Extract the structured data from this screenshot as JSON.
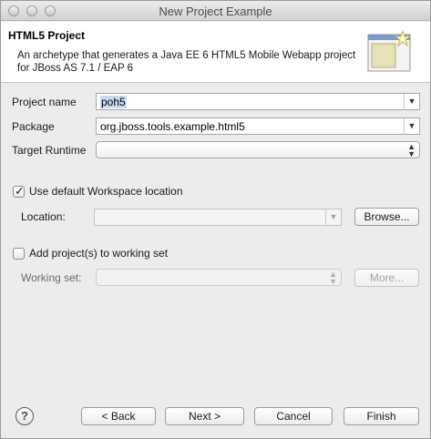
{
  "window": {
    "title": "New Project Example"
  },
  "banner": {
    "title": "HTML5 Project",
    "description": "An archetype that generates a Java EE 6 HTML5 Mobile Webapp project for JBoss AS 7.1 / EAP 6"
  },
  "form": {
    "project_name": {
      "label": "Project name",
      "value": "poh5"
    },
    "package": {
      "label": "Package",
      "value": "org.jboss.tools.example.html5"
    },
    "target_runtime": {
      "label": "Target Runtime",
      "value": ""
    },
    "use_default_location": {
      "label": "Use default Workspace location",
      "checked": true
    },
    "location": {
      "label": "Location:",
      "value": "",
      "browse_label": "Browse..."
    },
    "add_to_working_set": {
      "label": "Add project(s) to working set",
      "checked": false
    },
    "working_set": {
      "label": "Working set:",
      "value": "",
      "more_label": "More..."
    }
  },
  "footer": {
    "help_glyph": "?",
    "back_label": "< Back",
    "next_label": "Next >",
    "cancel_label": "Cancel",
    "finish_label": "Finish"
  },
  "icons": {
    "traffic_lights": [
      "close-icon",
      "minimize-icon",
      "zoom-icon"
    ],
    "wizard": "new-project-wizard-icon"
  }
}
